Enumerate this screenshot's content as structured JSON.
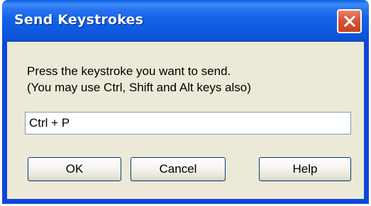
{
  "window": {
    "title": "Send Keystrokes"
  },
  "dialog": {
    "instruction_line1": "Press the keystroke you want to send.",
    "instruction_line2": "(You may use Ctrl, Shift and Alt keys also)",
    "keystroke_value": "Ctrl + P"
  },
  "buttons": {
    "ok_label": "OK",
    "cancel_label": "Cancel",
    "help_label": "Help"
  },
  "icons": {
    "close": "close-icon"
  },
  "colors": {
    "titlebar": "#0a5ee6",
    "close_button": "#d9573b",
    "client_background": "#ece9d8"
  }
}
